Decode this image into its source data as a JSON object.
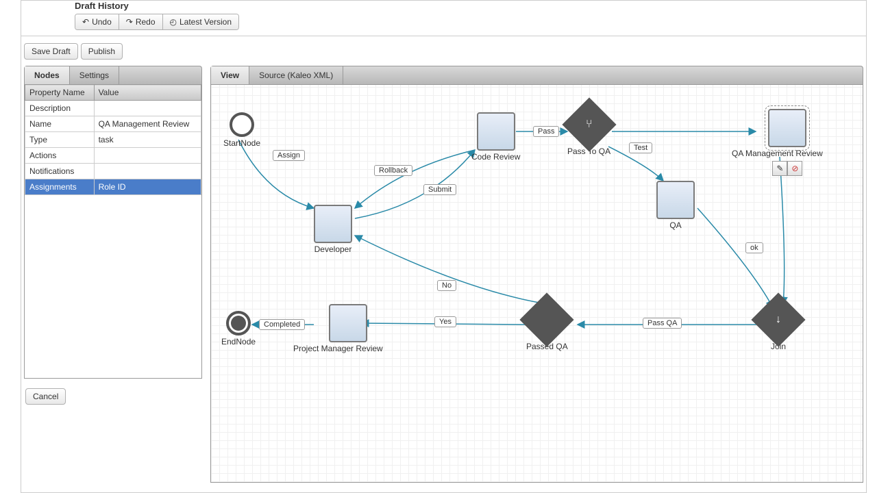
{
  "history": {
    "title": "Draft History",
    "undo": "Undo",
    "redo": "Redo",
    "latest": "Latest Version"
  },
  "actions": {
    "save_draft": "Save Draft",
    "publish": "Publish",
    "cancel": "Cancel"
  },
  "sidebar": {
    "tabs": [
      "Nodes",
      "Settings"
    ],
    "columns": {
      "prop": "Property Name",
      "val": "Value"
    },
    "rows": [
      {
        "prop": "Description",
        "val": ""
      },
      {
        "prop": "Name",
        "val": "QA Management Review"
      },
      {
        "prop": "Type",
        "val": "task"
      },
      {
        "prop": "Actions",
        "val": ""
      },
      {
        "prop": "Notifications",
        "val": ""
      },
      {
        "prop": "Assignments",
        "val": "Role ID"
      }
    ]
  },
  "canvas_tabs": {
    "view": "View",
    "source": "Source (Kaleo XML)"
  },
  "nodes": {
    "start": "StartNode",
    "developer": "Developer",
    "code_review": "Code Review",
    "pass_to_qa": "Pass To QA",
    "qa": "QA",
    "qa_mgmt": "QA Management Review",
    "join": "Join",
    "passed_qa": "Passed QA",
    "pm_review": "Project Manager Review",
    "end": "EndNode"
  },
  "edges": {
    "assign": "Assign",
    "submit": "Submit",
    "rollback": "Rollback",
    "pass": "Pass",
    "test": "Test",
    "ok": "ok",
    "pass_qa": "Pass QA",
    "yes": "Yes",
    "no": "No",
    "completed": "Completed"
  }
}
